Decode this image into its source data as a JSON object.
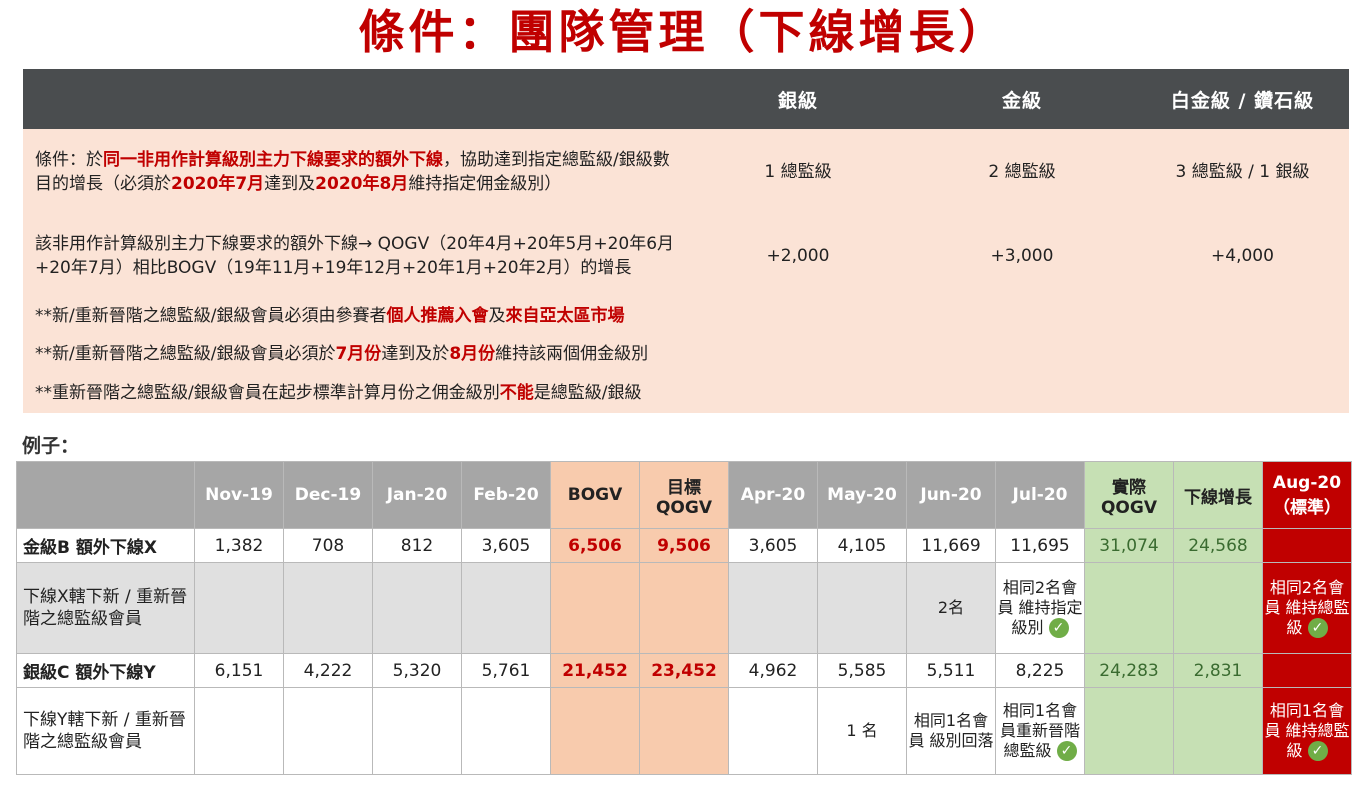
{
  "title": "條件：團隊管理（下線增長）",
  "conditions": {
    "headers": [
      "",
      "銀級",
      "金級",
      "白金級 / 鑽石級"
    ],
    "row1": {
      "text_a": "條件：於",
      "text_b": "同一非用作計算級別主力下線要求的額外下線",
      "text_c": "，協助達到指定總監級/銀級數目的增長（必須於",
      "text_d": "2020年7月",
      "text_e": "達到及",
      "text_f": "2020年8月",
      "text_g": "維持指定佣金級別）",
      "values": [
        "1 總監級",
        "2 總監級",
        "3 總監級 / 1 銀級"
      ]
    },
    "row2": {
      "text": "該非用作計算級別主力下線要求的額外下線→ QOGV（20年4月+20年5月+20年6月+20年7月）相比BOGV（19年11月+19年12月+20年1月+20年2月）的增長",
      "values": [
        "+2,000",
        "+3,000",
        "+4,000"
      ]
    },
    "note1": {
      "a": "**新/重新晉階之總監級/銀級會員必須由參賽者",
      "b": "個人推薦入會",
      "c": "及",
      "d": "來自亞太區市場"
    },
    "note2": {
      "a": "**新/重新晉階之總監級/銀級會員必須於",
      "b": "7月份",
      "c": "達到及於",
      "d": "8月份",
      "e": "維持該兩個佣金級別"
    },
    "note3": {
      "a": "**重新晉階之總監級/銀級會員在起步標準計算月份之佣金級別",
      "b": "不能",
      "c": "是總監級/銀級"
    }
  },
  "example_label": "例子：",
  "example": {
    "headers": [
      "",
      "Nov-19",
      "Dec-19",
      "Jan-20",
      "Feb-20",
      "BOGV",
      "目標 QOGV",
      "Apr-20",
      "May-20",
      "Jun-20",
      "Jul-20",
      "實際 QOGV",
      "下線增長",
      "Aug-20 （標準）"
    ],
    "row_b": {
      "label": "金級B 額外下線X",
      "values": [
        "1,382",
        "708",
        "812",
        "3,605",
        "6,506",
        "9,506",
        "3,605",
        "4,105",
        "11,669",
        "11,695",
        "31,074",
        "24,568",
        ""
      ]
    },
    "row_b_sub": {
      "label": "下線X轄下新 / 重新晉階之總監級會員",
      "jun": "2名",
      "jul": "相同2名會員 維持指定級別",
      "aug": "相同2名會員 維持總監級"
    },
    "row_c": {
      "label": "銀級C 額外下線Y",
      "values": [
        "6,151",
        "4,222",
        "5,320",
        "5,761",
        "21,452",
        "23,452",
        "4,962",
        "5,585",
        "5,511",
        "8,225",
        "24,283",
        "2,831",
        ""
      ]
    },
    "row_c_sub": {
      "label": "下線Y轄下新 / 重新晉階之總監級會員",
      "may": "1 名",
      "jun": "相同1名會員 級別回落",
      "jul": "相同1名會員重新晉階總監級",
      "aug": "相同1名會員 維持總監級"
    }
  },
  "colors": {
    "accent_red": "#c00000",
    "header_gray": "#4a4d4f",
    "peach": "#fbe3d6",
    "orange": "#f8cbad",
    "green": "#c6e0b4"
  },
  "icons": {
    "check": "check-circle-icon"
  }
}
